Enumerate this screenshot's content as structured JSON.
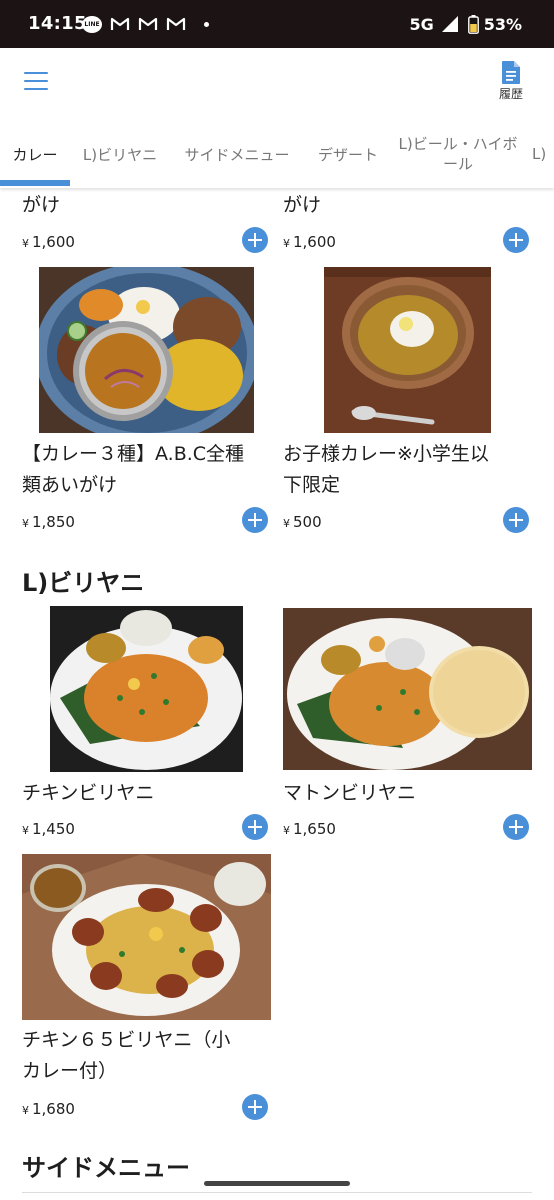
{
  "status_bar": {
    "time": "14:15",
    "notifications": [
      "line-icon",
      "gmail-icon",
      "gmail-icon",
      "gmail-icon"
    ],
    "network": "5G",
    "battery": "53%"
  },
  "header": {
    "history_label": "履歴"
  },
  "tabs": [
    {
      "label": "カレー",
      "active": true
    },
    {
      "label": "L)ビリヤニ",
      "active": false
    },
    {
      "label": "サイドメニュー",
      "active": false
    },
    {
      "label": "デザート",
      "active": false
    },
    {
      "label": "L)ビール・ハイボール",
      "active": false
    }
  ],
  "colors": {
    "accent": "#4a90d9",
    "status_bar_bg": "#1c1414"
  },
  "currency": "¥",
  "items": [
    {
      "title_tail": "がけ",
      "price": "1,600"
    },
    {
      "title_tail": "がけ",
      "price": "1,600"
    },
    {
      "title": "【カレー３種】A.B.C全種類あいがけ",
      "title_line1": "【カレー３種】A.B.C全種",
      "title_line2": "類あいがけ",
      "price": "1,850"
    },
    {
      "title": "お子様カレー※小学生以下限定",
      "title_line1": "お子様カレー※小学生以",
      "title_line2": "下限定",
      "price": "500"
    }
  ],
  "sections": [
    {
      "heading": "L)ビリヤニ",
      "items": [
        {
          "title": "チキンビリヤニ",
          "price": "1,450"
        },
        {
          "title": "マトンビリヤニ",
          "price": "1,650"
        },
        {
          "title": "チキン６５ビリヤニ（小カレー付）",
          "title_line1": "チキン６５ビリヤニ（小",
          "title_line2": "カレー付）",
          "price": "1,680"
        }
      ]
    },
    {
      "heading": "サイドメニュー"
    }
  ]
}
